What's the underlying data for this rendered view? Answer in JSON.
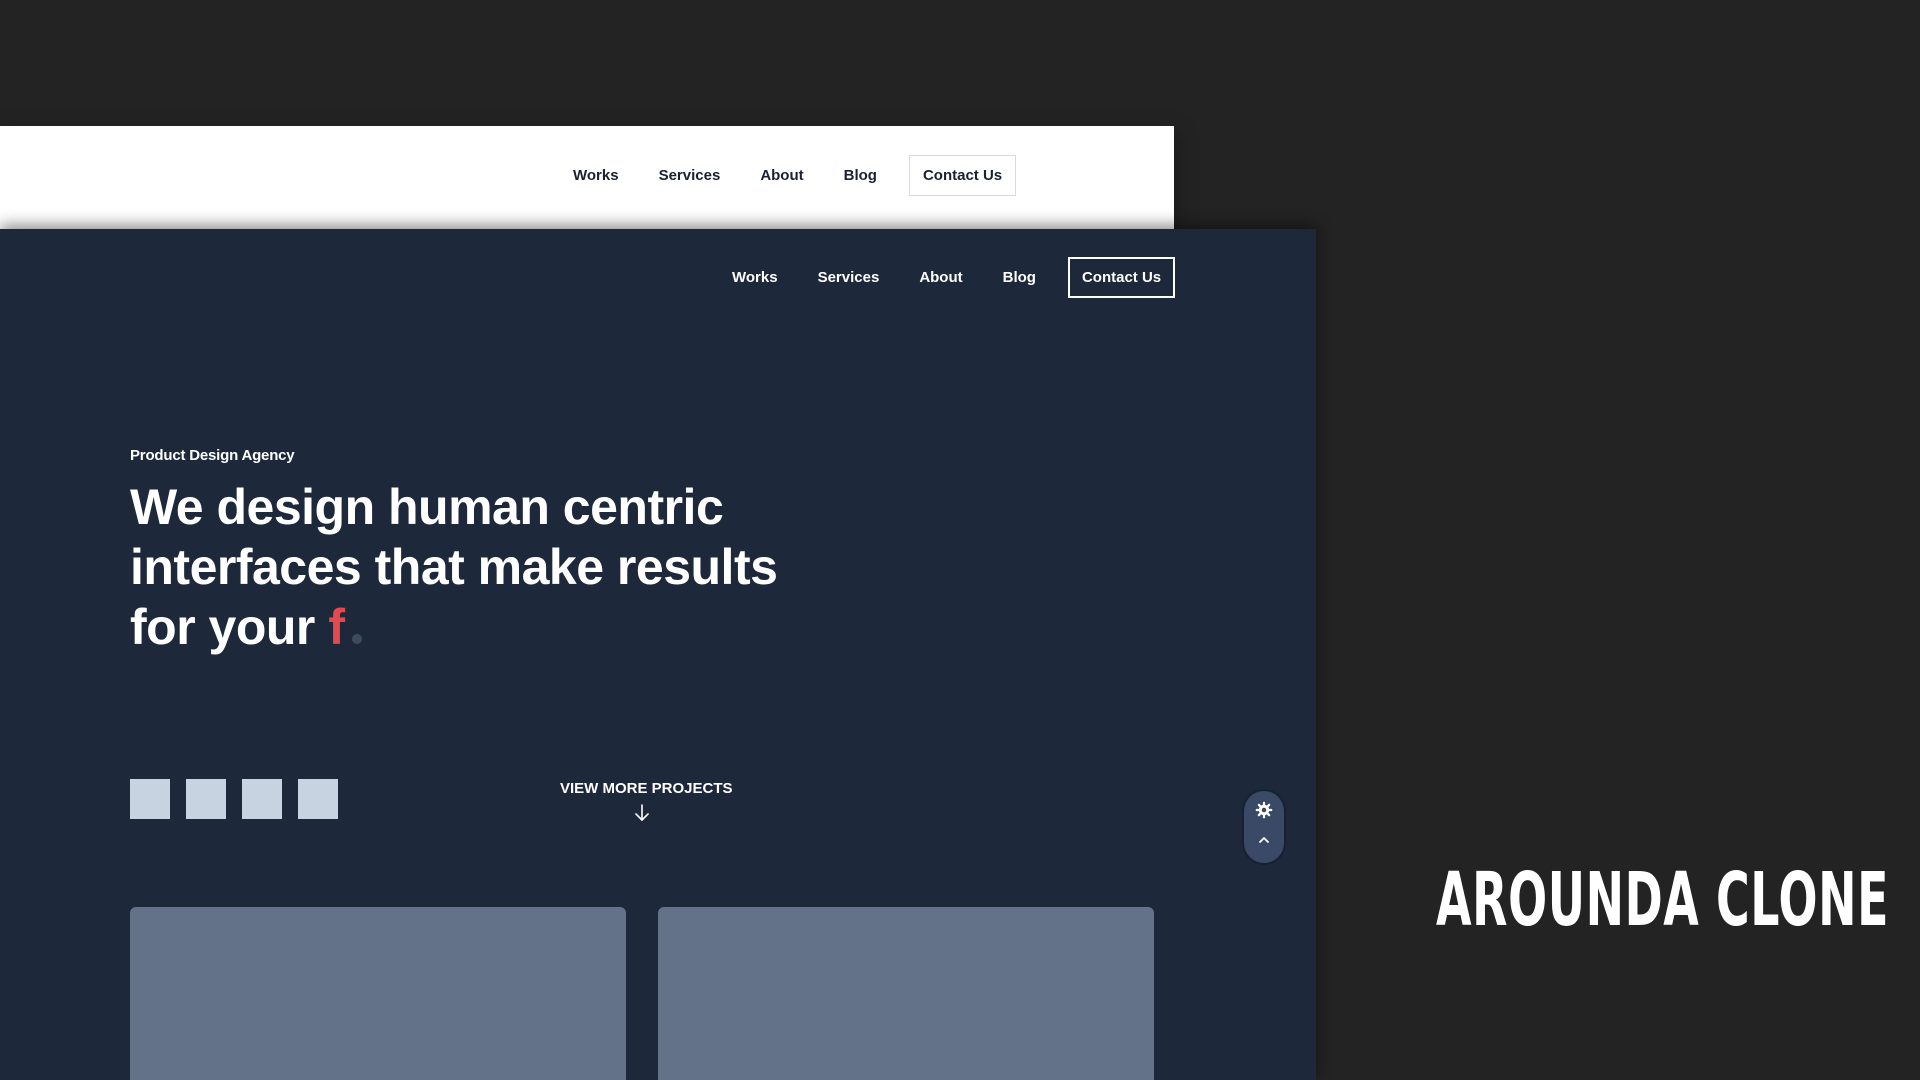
{
  "light_header": {
    "nav": [
      "Works",
      "Services",
      "About",
      "Blog"
    ],
    "contact_label": "Contact Us"
  },
  "dark_site": {
    "nav": [
      "Works",
      "Services",
      "About",
      "Blog"
    ],
    "contact_label": "Contact Us",
    "hero": {
      "eyebrow": "Product Design Agency",
      "headline_line1": "We design human centric",
      "headline_line2": "interfaces that make results",
      "headline_line3_prefix": "for your",
      "headline_typed": "f"
    },
    "social_icons": [
      "social-icon",
      "social-icon",
      "social-icon",
      "social-icon"
    ],
    "view_more_label": "VIEW MORE PROJECTS",
    "widget": {
      "settings_icon": "gear-icon",
      "scroll_top_icon": "caret-up-icon"
    }
  },
  "overlay_title": "AROUNDA CLONE",
  "colors": {
    "background": "#232323",
    "dark_site_bg": "#1e283b",
    "accent": "#e5484d",
    "card": "#637289",
    "social_square": "#c8d3e1"
  }
}
